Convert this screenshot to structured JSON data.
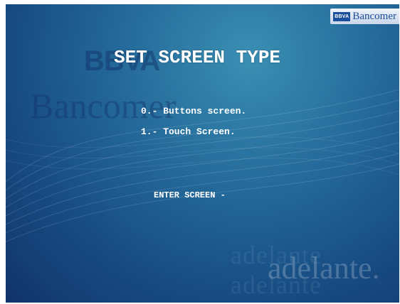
{
  "branding": {
    "corner_logo_mark": "BBVA",
    "corner_logo_word": "Bancomer",
    "watermark_bbva": "BBVA",
    "watermark_bancomer": "Bancomer",
    "watermark_adelante": "adelante.",
    "watermark_adelante_ghost": "adelante adelante"
  },
  "screen": {
    "title": "SET SCREEN TYPE",
    "options": [
      "0.- Buttons screen.",
      "1.- Touch Screen."
    ],
    "prompt": "ENTER SCREEN -"
  },
  "colors": {
    "background_top": "#3a8fb3",
    "background_bottom": "#11346a",
    "text": "#ffffff",
    "brand_blue": "#1c4f9b"
  }
}
